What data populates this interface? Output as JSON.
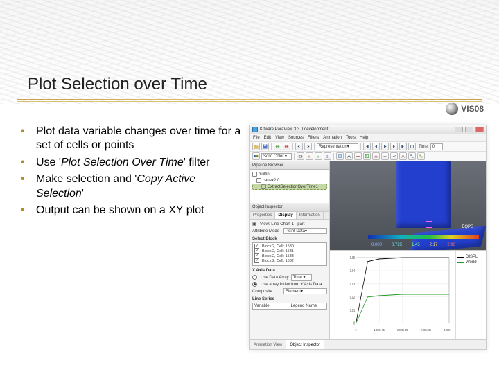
{
  "slide": {
    "title": "Plot Selection over Time",
    "logo_text": "VIS08",
    "bullets": [
      {
        "pre": "Plot data variable changes over time for a set of cells or points"
      },
      {
        "pre": "Use '",
        "em": "Plot Selection Over Time",
        "post": "' filter"
      },
      {
        "pre": "Make selection and '",
        "em": "Copy Active Selection",
        "post": "'"
      },
      {
        "pre": "Output can be shown on a XY plot"
      }
    ]
  },
  "app": {
    "window_title": "Kitware ParaView 3.3.0 development",
    "menus": [
      "File",
      "Edit",
      "View",
      "Sources",
      "Filters",
      "Animation",
      "Tools",
      "Help"
    ],
    "toolbar": {
      "repr_label": "Representation",
      "time_label": "Time:",
      "time_value": "0"
    },
    "pipeline": {
      "title": "Pipeline Browser",
      "items": [
        {
          "label": "builtin:"
        },
        {
          "label": "canex2.0"
        },
        {
          "label": "ExtractSelectionOverTime1",
          "selected": true
        }
      ]
    },
    "inspector": {
      "title": "Object Inspector",
      "tabs": [
        "Properties",
        "Display",
        "Information"
      ],
      "active_tab": "Display",
      "view_label": "View: Line Chart 1 - part",
      "attr_mode_label": "Attribute Mode",
      "attr_mode_value": "Point Data",
      "block_label": "Select Block",
      "blocks": [
        "Block 2, Cell: 1530",
        "Block 2, Cell: 1531",
        "Block 2, Cell: 1533",
        "Block 2, Cell: 1532"
      ],
      "xaxis_label": "X Axis Data",
      "xaxis_opt1": "Use Data Array",
      "xaxis_opt2": "Use array Index from Y Axis Data",
      "composite_label": "Composite",
      "composite_value": "Element",
      "lineseries_label": "Line Series",
      "col_variable": "Variable",
      "col_legend": "Legend Name"
    },
    "view3d": {
      "eqps": "EQPS",
      "ticks": [
        "0.000",
        "0.725",
        "1.45",
        "2.17",
        "2.90"
      ]
    },
    "bottom_tabs": [
      "Animation View",
      "Object Inspector"
    ]
  },
  "chart_data": {
    "type": "line",
    "x": [
      0,
      5e-06,
      1e-05,
      2e-05,
      3e-05,
      4e-05
    ],
    "series": [
      {
        "name": "DISPL",
        "color": "#000000",
        "values": [
          0.0,
          0.047,
          0.049,
          0.05,
          0.05,
          0.05
        ]
      },
      {
        "name": "World",
        "color": "#2a9a2a",
        "values": [
          0.0,
          0.02,
          0.021,
          0.022,
          0.022,
          0.022
        ]
      }
    ],
    "ylim": [
      0,
      0.05
    ],
    "yticks": [
      "0",
      "0.01",
      "0.02",
      "0.03",
      "0.04",
      "0.05"
    ],
    "xticks": [
      "0",
      "1.000e-05",
      "2.000e-05",
      "3.000e-05",
      "4.000e-05"
    ]
  }
}
